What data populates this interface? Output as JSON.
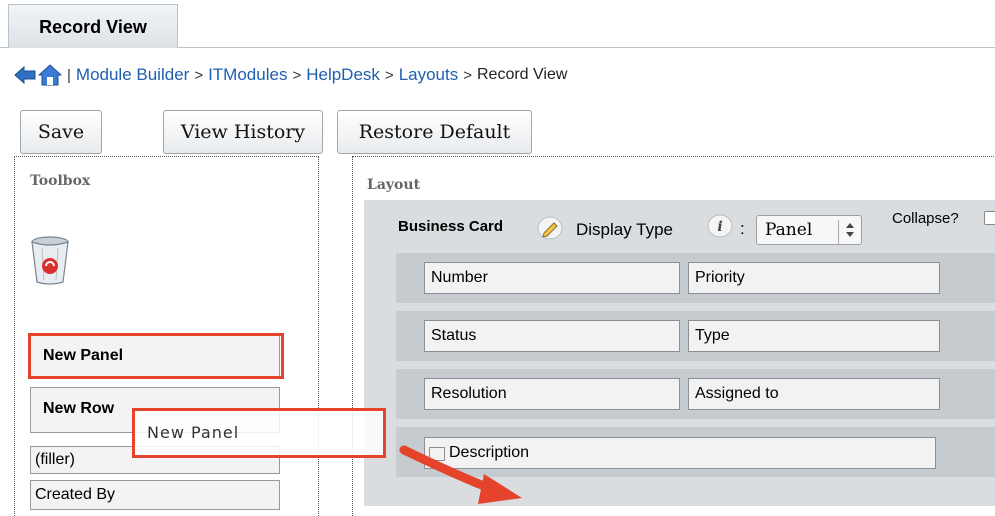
{
  "tab": {
    "label": "Record View"
  },
  "breadcrumb": {
    "items": [
      "Module Builder",
      "ITModules",
      "HelpDesk",
      "Layouts"
    ],
    "current": "Record View",
    "separator": ">",
    "pipe": "|"
  },
  "toolbar": {
    "save": "Save",
    "view_history": "View History",
    "restore_default": "Restore Default"
  },
  "toolbox": {
    "title": "Toolbox",
    "new_panel": "New Panel",
    "new_row": "New Row",
    "filler": "(filler)",
    "created_by": "Created By"
  },
  "drag_ghost": {
    "label": "New Panel"
  },
  "layout": {
    "title": "Layout",
    "panel_name": "Business Card",
    "display_type_label": "Display Type",
    "colon": ":",
    "display_type_value": "Panel",
    "collapse_label": "Collapse?",
    "rows": [
      [
        "Number",
        "Priority"
      ],
      [
        "Status",
        "Type"
      ],
      [
        "Resolution",
        "Assigned to"
      ]
    ],
    "description": "Description"
  },
  "colors": {
    "highlight": "#e5432b",
    "link": "#1f5fb0"
  },
  "icons": [
    "back-arrow-icon",
    "home-icon",
    "trash-can-icon",
    "pencil-icon",
    "info-icon",
    "select-arrows-icon",
    "pointer-arrow-icon"
  ]
}
